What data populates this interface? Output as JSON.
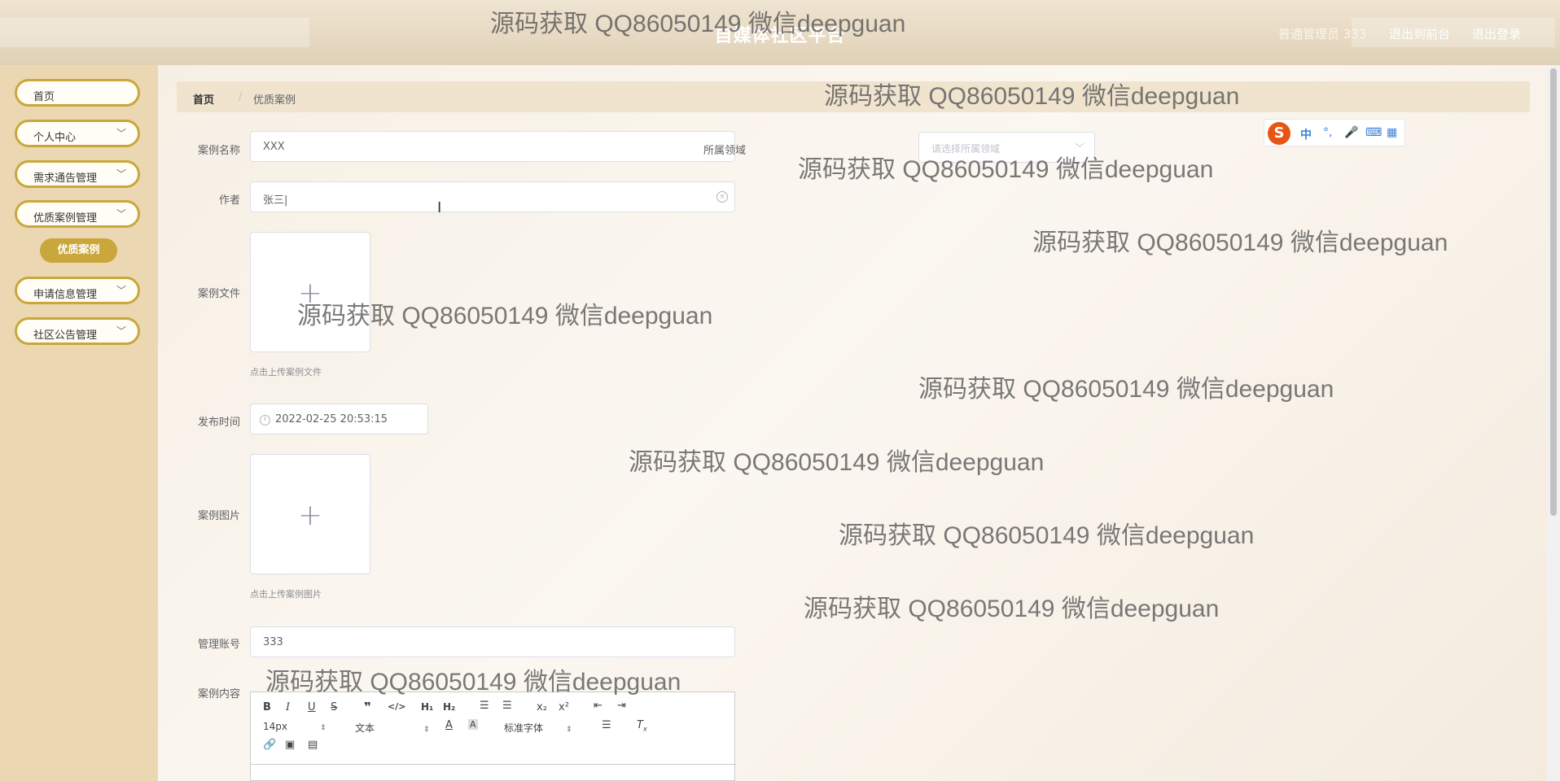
{
  "header": {
    "title": "自媒体社区平台",
    "user_label": "普通管理员 333",
    "front_link": "退出到前台",
    "logout_link": "退出登录"
  },
  "sidebar": {
    "items": [
      {
        "label": "首页"
      },
      {
        "label": "个人中心",
        "icon": "chevron-down-icon"
      },
      {
        "label": "需求通告管理",
        "icon": "chevron-down-icon"
      },
      {
        "label": "优质案例管理",
        "icon": "chevron-down-icon"
      },
      {
        "label": "申请信息管理",
        "icon": "chevron-down-icon"
      },
      {
        "label": "社区公告管理",
        "icon": "chevron-down-icon"
      }
    ],
    "active_sub": "优质案例"
  },
  "breadcrumb": {
    "home": "首页",
    "separator": "/",
    "current": "优质案例"
  },
  "form": {
    "name": {
      "label": "案例名称",
      "value": "XXX"
    },
    "domain": {
      "label": "所属领域",
      "placeholder": "请选择所属领域"
    },
    "author": {
      "label": "作者",
      "value": "张三|"
    },
    "file": {
      "label": "案例文件",
      "tip": "点击上传案例文件"
    },
    "publish_time": {
      "label": "发布时间",
      "value": "2022-02-25 20:53:15"
    },
    "image": {
      "label": "案例图片",
      "tip": "点击上传案例图片"
    },
    "account": {
      "label": "管理账号",
      "value": "333"
    },
    "content": {
      "label": "案例内容"
    }
  },
  "editor": {
    "font_size": "14px",
    "block_type": "文本",
    "font_family": "标准字体"
  },
  "ime": {
    "mode": "中",
    "logo": "S"
  },
  "watermark": "源码获取 QQ86050149 微信deepguan",
  "colors": {
    "accent": "#c9a73a",
    "sidebar_bg": "#ebd7b2",
    "header_bg": "#e9dcc6"
  }
}
